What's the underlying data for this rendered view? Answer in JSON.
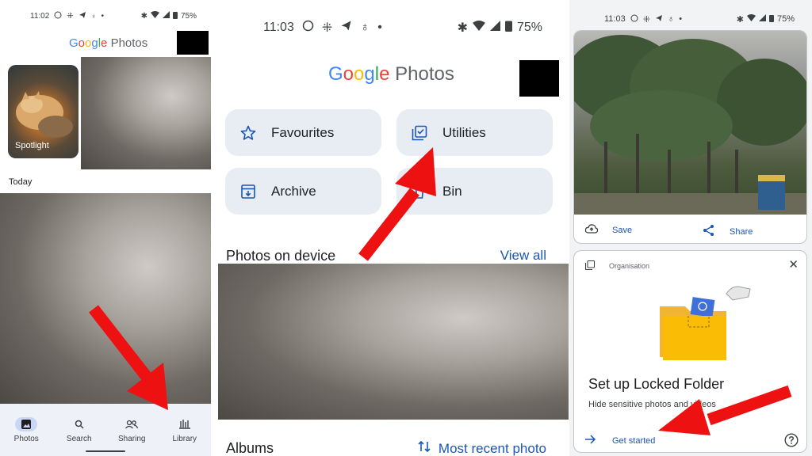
{
  "panel1": {
    "status": {
      "time": "11:02",
      "battery": "75%"
    },
    "logo": {
      "g1": "G",
      "o1": "o",
      "o2": "o",
      "g2": "g",
      "l": "l",
      "e": "e",
      "photos": "Photos"
    },
    "spotlight_label": "Spotlight",
    "section_today": "Today",
    "nav": [
      {
        "label": "Photos",
        "icon": "photo-icon"
      },
      {
        "label": "Search",
        "icon": "search-icon"
      },
      {
        "label": "Sharing",
        "icon": "people-icon"
      },
      {
        "label": "Library",
        "icon": "library-icon"
      }
    ]
  },
  "panel2": {
    "status": {
      "time": "11:03",
      "battery": "75%"
    },
    "logo": {
      "g1": "G",
      "o1": "o",
      "o2": "o",
      "g2": "g",
      "l": "l",
      "e": "e",
      "photos": "Photos"
    },
    "tiles": {
      "favourites": "Favourites",
      "utilities": "Utilities",
      "archive": "Archive",
      "bin": "Bin"
    },
    "photos_on_device": "Photos on device",
    "view_all": "View all",
    "albums": "Albums",
    "most_recent": "Most recent photo"
  },
  "panel3": {
    "status": {
      "time": "11:03",
      "battery": "75%"
    },
    "save": "Save",
    "share": "Share",
    "card_label": "Organisation",
    "title": "Set up Locked Folder",
    "subtitle": "Hide sensitive photos and videos",
    "get_started": "Get started"
  },
  "colors": {
    "accent": "#1a73e8",
    "arrow": "#ee1111",
    "tile_bg": "#e8edf4"
  }
}
